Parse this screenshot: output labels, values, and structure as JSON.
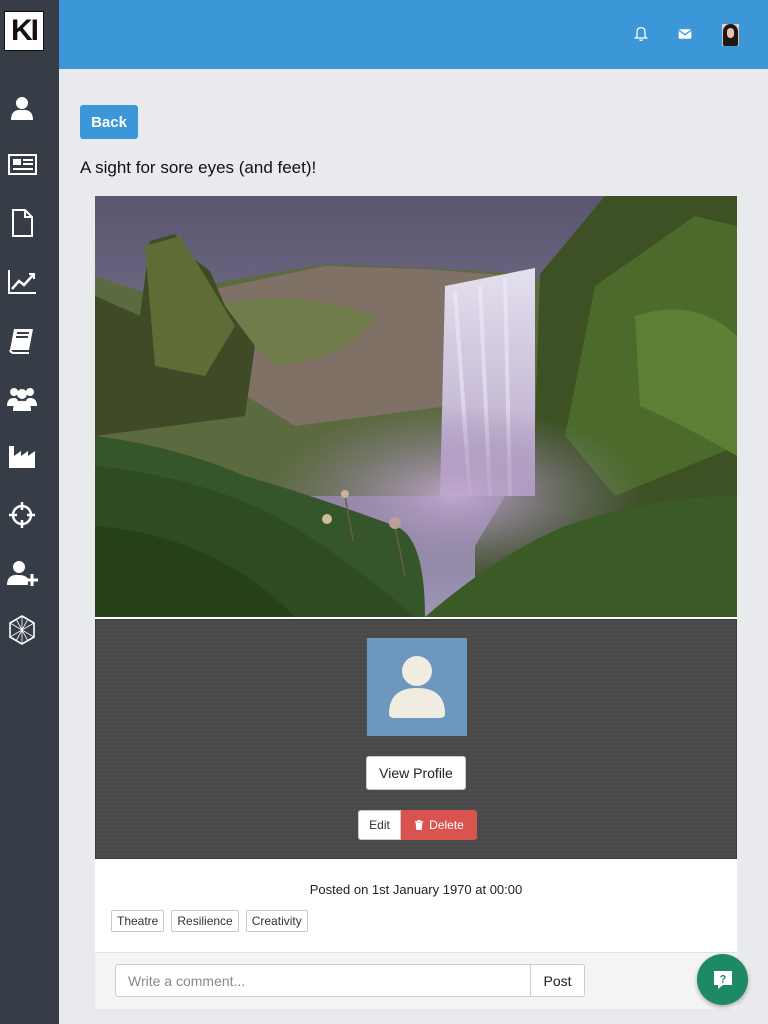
{
  "app": {
    "logo_text": "KI",
    "accent_color": "#3b97d8",
    "sidebar_color": "#363d46"
  },
  "sidebar": {
    "items": [
      {
        "icon": "user-icon"
      },
      {
        "icon": "newspaper-icon"
      },
      {
        "icon": "document-icon"
      },
      {
        "icon": "chart-line-icon"
      },
      {
        "icon": "book-icon"
      },
      {
        "icon": "users-group-icon"
      },
      {
        "icon": "industry-icon"
      },
      {
        "icon": "crosshairs-icon"
      },
      {
        "icon": "user-plus-icon"
      },
      {
        "icon": "hexagon-network-icon"
      }
    ]
  },
  "topbar": {
    "icons": [
      "bell-icon",
      "envelope-icon",
      "user-avatar"
    ]
  },
  "page": {
    "back_label": "Back",
    "post_title": "A sight for sore eyes (and feet)!"
  },
  "post": {
    "image_description_icon": "waterfall-photo",
    "view_profile_label": "View Profile",
    "edit_label": "Edit",
    "delete_label": "Delete",
    "posted_text": "Posted on 1st January 1970 at 00:00",
    "tags": [
      "Theatre",
      "Resilience",
      "Creativity"
    ]
  },
  "comment": {
    "placeholder": "Write a comment...",
    "post_label": "Post"
  },
  "help": {
    "icon": "question-chat-icon",
    "color": "#1e8a64"
  }
}
